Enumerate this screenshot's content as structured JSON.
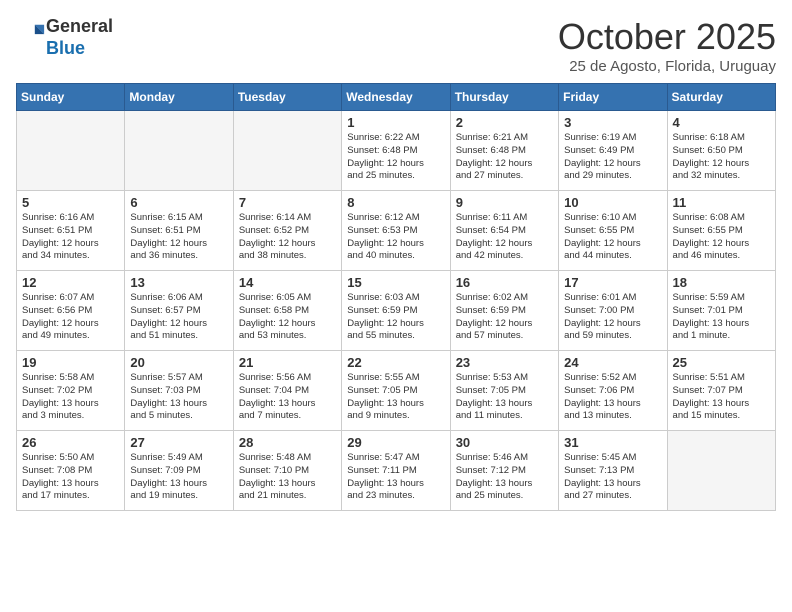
{
  "header": {
    "logo_general": "General",
    "logo_blue": "Blue",
    "month_title": "October 2025",
    "subtitle": "25 de Agosto, Florida, Uruguay"
  },
  "days_of_week": [
    "Sunday",
    "Monday",
    "Tuesday",
    "Wednesday",
    "Thursday",
    "Friday",
    "Saturday"
  ],
  "weeks": [
    [
      {
        "day": "",
        "info": ""
      },
      {
        "day": "",
        "info": ""
      },
      {
        "day": "",
        "info": ""
      },
      {
        "day": "1",
        "info": "Sunrise: 6:22 AM\nSunset: 6:48 PM\nDaylight: 12 hours\nand 25 minutes."
      },
      {
        "day": "2",
        "info": "Sunrise: 6:21 AM\nSunset: 6:48 PM\nDaylight: 12 hours\nand 27 minutes."
      },
      {
        "day": "3",
        "info": "Sunrise: 6:19 AM\nSunset: 6:49 PM\nDaylight: 12 hours\nand 29 minutes."
      },
      {
        "day": "4",
        "info": "Sunrise: 6:18 AM\nSunset: 6:50 PM\nDaylight: 12 hours\nand 32 minutes."
      }
    ],
    [
      {
        "day": "5",
        "info": "Sunrise: 6:16 AM\nSunset: 6:51 PM\nDaylight: 12 hours\nand 34 minutes."
      },
      {
        "day": "6",
        "info": "Sunrise: 6:15 AM\nSunset: 6:51 PM\nDaylight: 12 hours\nand 36 minutes."
      },
      {
        "day": "7",
        "info": "Sunrise: 6:14 AM\nSunset: 6:52 PM\nDaylight: 12 hours\nand 38 minutes."
      },
      {
        "day": "8",
        "info": "Sunrise: 6:12 AM\nSunset: 6:53 PM\nDaylight: 12 hours\nand 40 minutes."
      },
      {
        "day": "9",
        "info": "Sunrise: 6:11 AM\nSunset: 6:54 PM\nDaylight: 12 hours\nand 42 minutes."
      },
      {
        "day": "10",
        "info": "Sunrise: 6:10 AM\nSunset: 6:55 PM\nDaylight: 12 hours\nand 44 minutes."
      },
      {
        "day": "11",
        "info": "Sunrise: 6:08 AM\nSunset: 6:55 PM\nDaylight: 12 hours\nand 46 minutes."
      }
    ],
    [
      {
        "day": "12",
        "info": "Sunrise: 6:07 AM\nSunset: 6:56 PM\nDaylight: 12 hours\nand 49 minutes."
      },
      {
        "day": "13",
        "info": "Sunrise: 6:06 AM\nSunset: 6:57 PM\nDaylight: 12 hours\nand 51 minutes."
      },
      {
        "day": "14",
        "info": "Sunrise: 6:05 AM\nSunset: 6:58 PM\nDaylight: 12 hours\nand 53 minutes."
      },
      {
        "day": "15",
        "info": "Sunrise: 6:03 AM\nSunset: 6:59 PM\nDaylight: 12 hours\nand 55 minutes."
      },
      {
        "day": "16",
        "info": "Sunrise: 6:02 AM\nSunset: 6:59 PM\nDaylight: 12 hours\nand 57 minutes."
      },
      {
        "day": "17",
        "info": "Sunrise: 6:01 AM\nSunset: 7:00 PM\nDaylight: 12 hours\nand 59 minutes."
      },
      {
        "day": "18",
        "info": "Sunrise: 5:59 AM\nSunset: 7:01 PM\nDaylight: 13 hours\nand 1 minute."
      }
    ],
    [
      {
        "day": "19",
        "info": "Sunrise: 5:58 AM\nSunset: 7:02 PM\nDaylight: 13 hours\nand 3 minutes."
      },
      {
        "day": "20",
        "info": "Sunrise: 5:57 AM\nSunset: 7:03 PM\nDaylight: 13 hours\nand 5 minutes."
      },
      {
        "day": "21",
        "info": "Sunrise: 5:56 AM\nSunset: 7:04 PM\nDaylight: 13 hours\nand 7 minutes."
      },
      {
        "day": "22",
        "info": "Sunrise: 5:55 AM\nSunset: 7:05 PM\nDaylight: 13 hours\nand 9 minutes."
      },
      {
        "day": "23",
        "info": "Sunrise: 5:53 AM\nSunset: 7:05 PM\nDaylight: 13 hours\nand 11 minutes."
      },
      {
        "day": "24",
        "info": "Sunrise: 5:52 AM\nSunset: 7:06 PM\nDaylight: 13 hours\nand 13 minutes."
      },
      {
        "day": "25",
        "info": "Sunrise: 5:51 AM\nSunset: 7:07 PM\nDaylight: 13 hours\nand 15 minutes."
      }
    ],
    [
      {
        "day": "26",
        "info": "Sunrise: 5:50 AM\nSunset: 7:08 PM\nDaylight: 13 hours\nand 17 minutes."
      },
      {
        "day": "27",
        "info": "Sunrise: 5:49 AM\nSunset: 7:09 PM\nDaylight: 13 hours\nand 19 minutes."
      },
      {
        "day": "28",
        "info": "Sunrise: 5:48 AM\nSunset: 7:10 PM\nDaylight: 13 hours\nand 21 minutes."
      },
      {
        "day": "29",
        "info": "Sunrise: 5:47 AM\nSunset: 7:11 PM\nDaylight: 13 hours\nand 23 minutes."
      },
      {
        "day": "30",
        "info": "Sunrise: 5:46 AM\nSunset: 7:12 PM\nDaylight: 13 hours\nand 25 minutes."
      },
      {
        "day": "31",
        "info": "Sunrise: 5:45 AM\nSunset: 7:13 PM\nDaylight: 13 hours\nand 27 minutes."
      },
      {
        "day": "",
        "info": ""
      }
    ]
  ]
}
